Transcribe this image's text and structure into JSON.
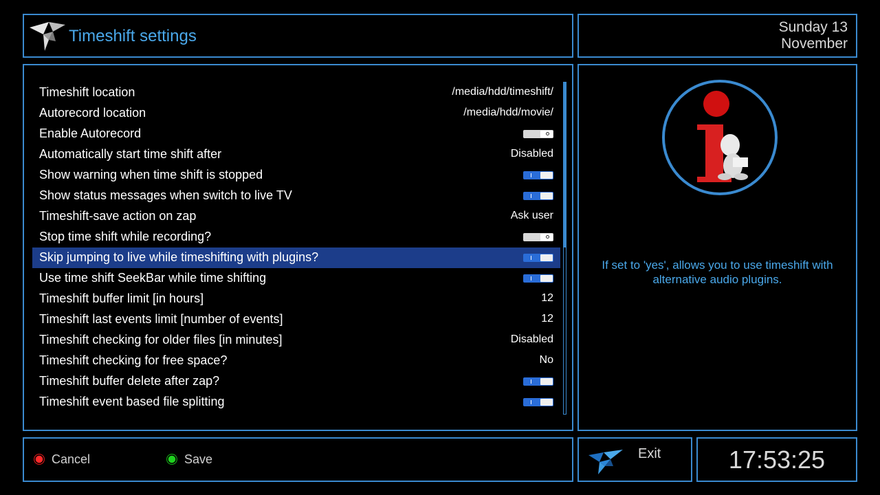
{
  "header": {
    "title": "Timeshift settings"
  },
  "date": {
    "line1": "Sunday 13",
    "line2": "November"
  },
  "settings": [
    {
      "label": "Timeshift location",
      "type": "text",
      "value": "/media/hdd/timeshift/"
    },
    {
      "label": "Autorecord location",
      "type": "text",
      "value": "/media/hdd/movie/"
    },
    {
      "label": "Enable Autorecord",
      "type": "toggle",
      "value": "off"
    },
    {
      "label": "Automatically start time shift after",
      "type": "text",
      "value": "Disabled"
    },
    {
      "label": "Show warning when time shift is stopped",
      "type": "toggle",
      "value": "on"
    },
    {
      "label": "Show status messages when switch to live TV",
      "type": "toggle",
      "value": "on"
    },
    {
      "label": "Timeshift-save action on zap",
      "type": "text",
      "value": "Ask user"
    },
    {
      "label": "Stop time shift while recording?",
      "type": "toggle",
      "value": "off"
    },
    {
      "label": "Skip jumping to live while timeshifting with plugins?",
      "type": "toggle",
      "value": "on",
      "selected": true
    },
    {
      "label": "Use time shift SeekBar while time shifting",
      "type": "toggle",
      "value": "on"
    },
    {
      "label": "Timeshift buffer limit [in hours]",
      "type": "text",
      "value": "12"
    },
    {
      "label": "Timeshift last events limit [number of events]",
      "type": "text",
      "value": "12"
    },
    {
      "label": "Timeshift checking for older files [in minutes]",
      "type": "text",
      "value": "Disabled"
    },
    {
      "label": "Timeshift checking for free space?",
      "type": "text",
      "value": "No"
    },
    {
      "label": "Timeshift buffer delete after zap?",
      "type": "toggle",
      "value": "on"
    },
    {
      "label": "Timeshift event based file splitting",
      "type": "toggle",
      "value": "on"
    }
  ],
  "info": {
    "icon": "info-icon",
    "text": "If set to 'yes', allows you to use timeshift with alternative audio plugins."
  },
  "buttons": {
    "cancel_label": "Cancel",
    "save_label": "Save",
    "exit_label": "Exit"
  },
  "clock": {
    "time": "17:53:25"
  },
  "colors": {
    "accent": "#3a8ad0",
    "title": "#4aa8ea",
    "selection": "#1c3d8a",
    "toggle_on": "#2a6dd8",
    "red_button": "#ff2a2a",
    "green_button": "#1ed01e"
  }
}
